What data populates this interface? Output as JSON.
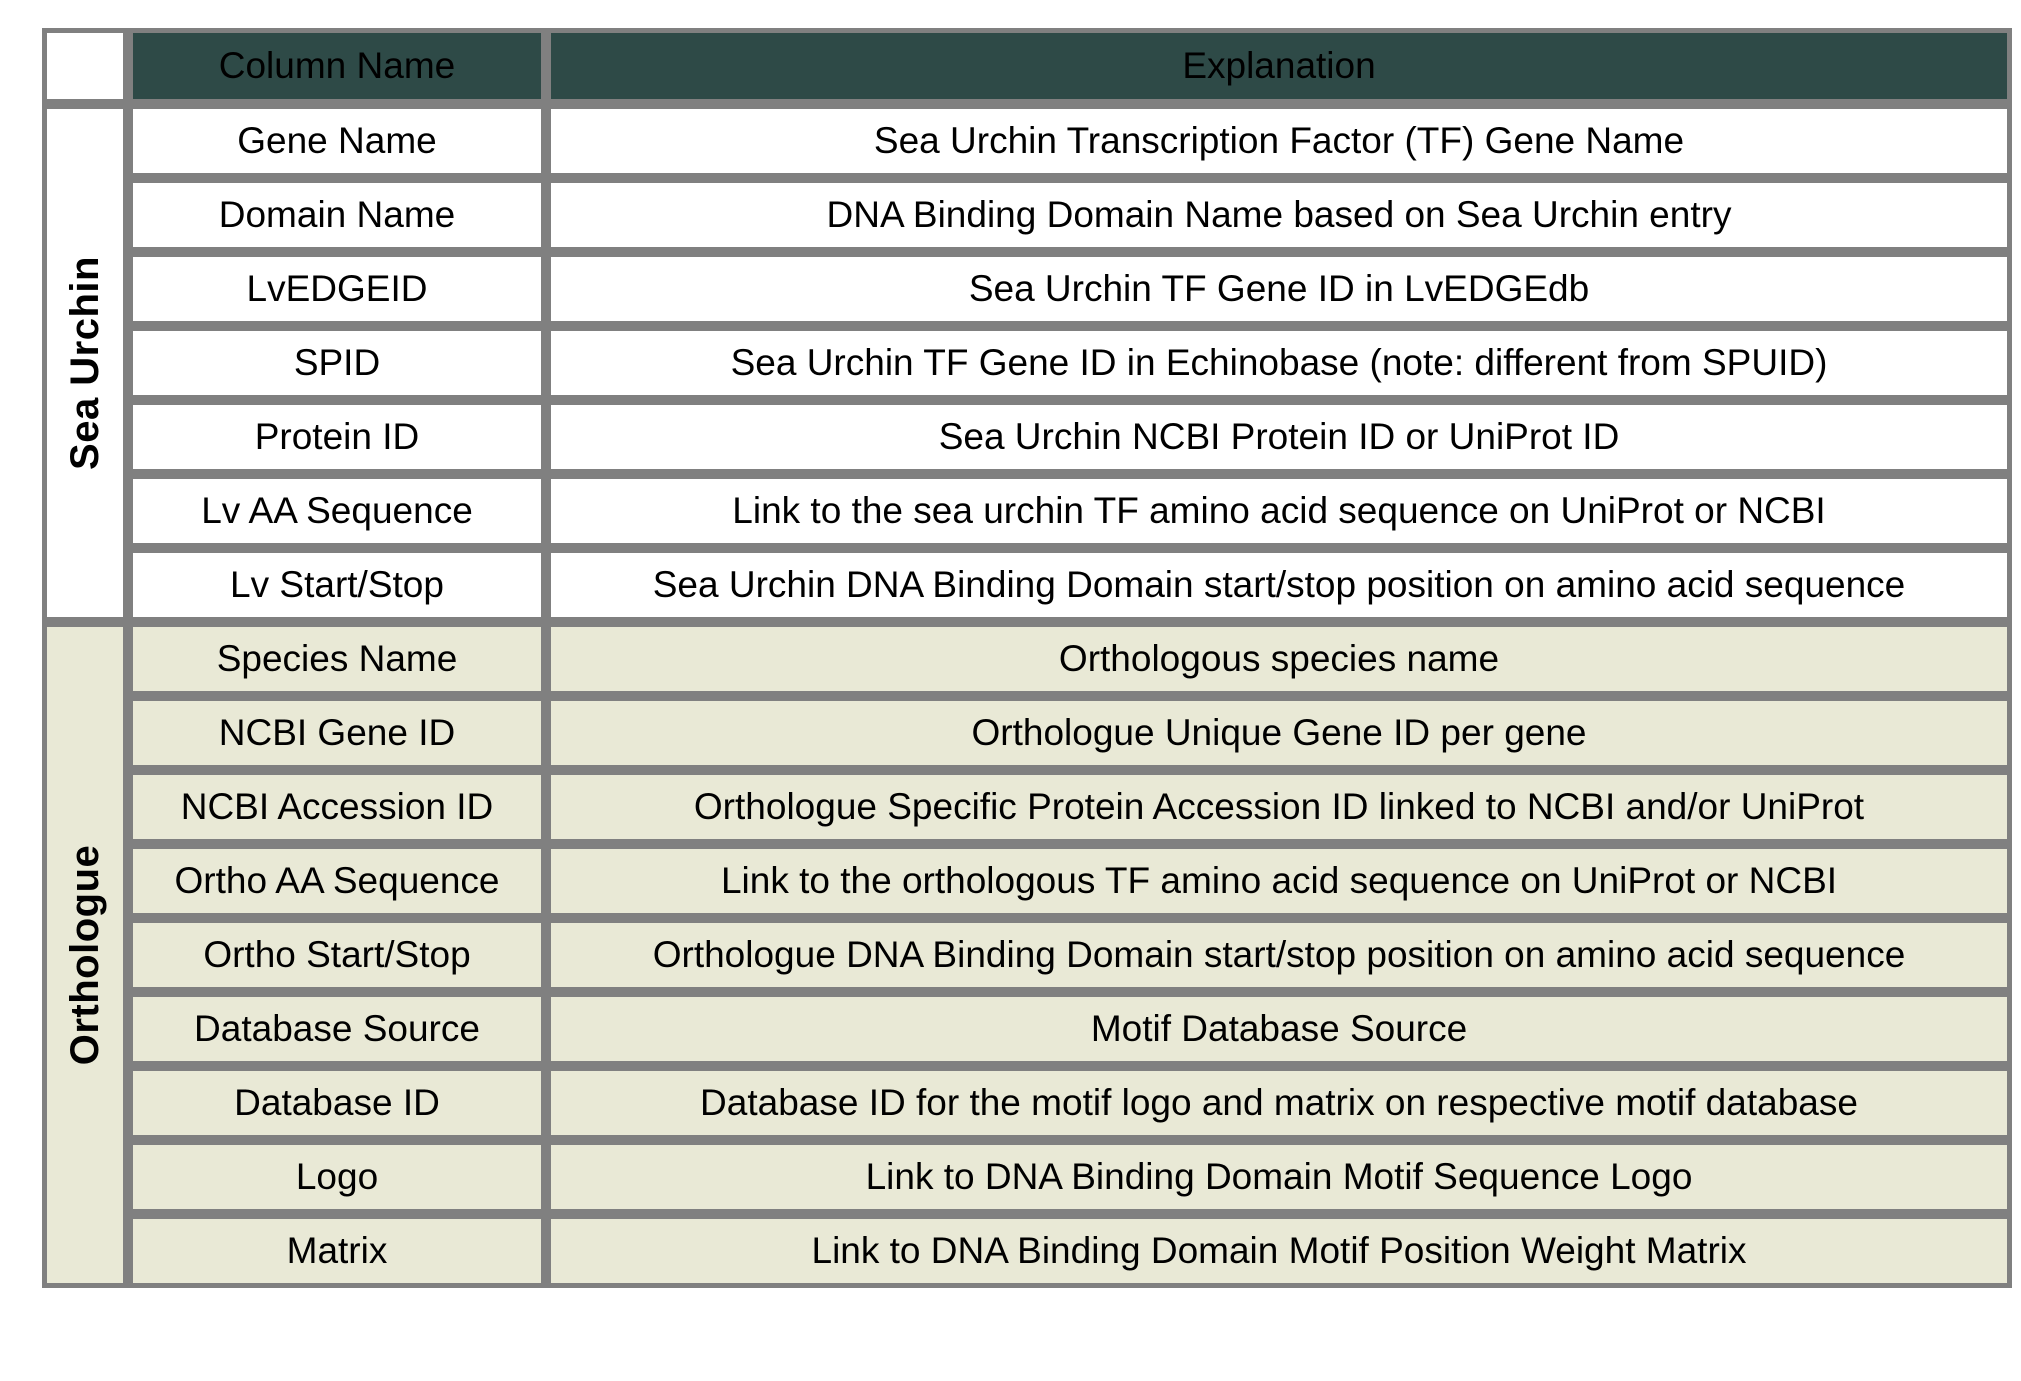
{
  "table": {
    "header": {
      "column_name_label": "Column Name",
      "explanation_label": "Explanation",
      "header_bg_color": "#2E4A47",
      "header_text_color": "#FFFFFF",
      "border_color": "#808080"
    },
    "groups": [
      {
        "label": "Sea Urchin",
        "bg_color": "#FFFFFF",
        "rows": [
          {
            "column_name": "Gene Name",
            "explanation": "Sea Urchin Transcription Factor (TF) Gene Name"
          },
          {
            "column_name": "Domain Name",
            "explanation": "DNA Binding Domain Name based on Sea Urchin entry"
          },
          {
            "column_name": "LvEDGEID",
            "explanation": "Sea Urchin TF Gene ID in LvEDGEdb"
          },
          {
            "column_name": "SPID",
            "explanation": "Sea Urchin TF Gene ID in Echinobase (note: different from SPUID)"
          },
          {
            "column_name": "Protein ID",
            "explanation": "Sea Urchin NCBI Protein ID or UniProt ID"
          },
          {
            "column_name": "Lv AA Sequence",
            "explanation": "Link to the sea urchin TF amino acid sequence on UniProt or NCBI"
          },
          {
            "column_name": "Lv Start/Stop",
            "explanation": "Sea Urchin DNA Binding Domain start/stop position on amino acid sequence"
          }
        ]
      },
      {
        "label": "Orthologue",
        "bg_color": "#E9E9D6",
        "rows": [
          {
            "column_name": "Species Name",
            "explanation": "Orthologous species name"
          },
          {
            "column_name": "NCBI Gene ID",
            "explanation": "Orthologue Unique Gene ID per gene"
          },
          {
            "column_name": "NCBI Accession ID",
            "explanation": "Orthologue Specific Protein Accession ID linked to NCBI and/or UniProt"
          },
          {
            "column_name": "Ortho AA Sequence",
            "explanation": "Link to the orthologous TF amino acid sequence on UniProt or NCBI"
          },
          {
            "column_name": "Ortho Start/Stop",
            "explanation": "Orthologue DNA Binding Domain start/stop position on amino acid sequence"
          },
          {
            "column_name": "Database Source",
            "explanation": "Motif Database Source"
          },
          {
            "column_name": "Database ID",
            "explanation": "Database ID for the motif logo and matrix on respective motif database"
          },
          {
            "column_name": "Logo",
            "explanation": "Link to DNA Binding Domain Motif Sequence Logo"
          },
          {
            "column_name": "Matrix",
            "explanation": "Link to DNA Binding Domain Motif Position Weight Matrix"
          }
        ]
      }
    ]
  }
}
